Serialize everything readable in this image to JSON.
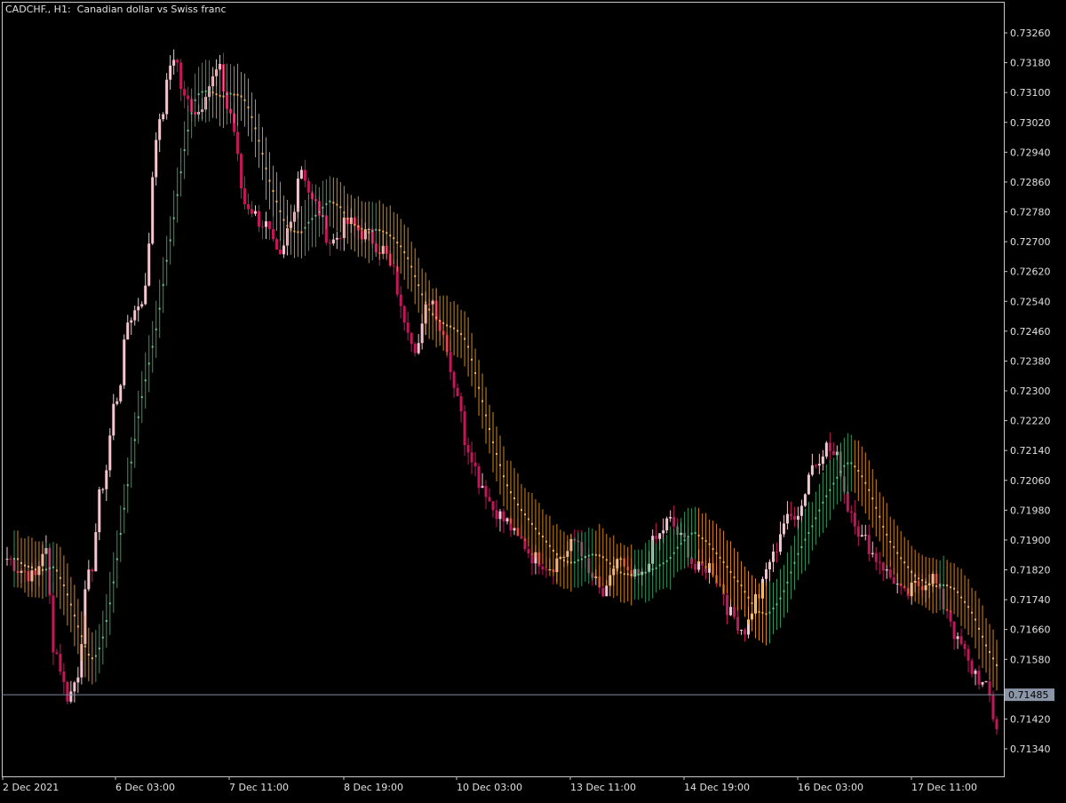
{
  "window": {
    "title": "CADCHF., H1:  Canadian dollar vs Swiss franc"
  },
  "colors": {
    "background": "#000000",
    "frame": "#c8c8c8",
    "text": "#e0e0e0",
    "bull_candle": "#f4c6cf",
    "bear_candle": "#c2185b",
    "band_up": "#3cb371",
    "band_down": "#ff9f1a",
    "price_line": "#7a8aa0",
    "price_label_bg": "#8a96a8"
  },
  "chart_data": {
    "type": "candlestick",
    "symbol": "CADCHF.",
    "timeframe": "H1",
    "description": "Canadian dollar vs Swiss franc",
    "ylim": [
      0.713,
      0.733
    ],
    "y_ticks": [
      "0.73260",
      "0.73180",
      "0.73100",
      "0.73020",
      "0.72940",
      "0.72860",
      "0.72780",
      "0.72700",
      "0.72620",
      "0.72540",
      "0.72460",
      "0.72380",
      "0.72300",
      "0.72220",
      "0.72140",
      "0.72060",
      "0.71980",
      "0.71900",
      "0.71820",
      "0.71740",
      "0.71660",
      "0.71580",
      "0.71420",
      "0.71340"
    ],
    "x_ticks": [
      "2 Dec 2021",
      "6 Dec 03:00",
      "7 Dec 11:00",
      "8 Dec 19:00",
      "10 Dec 03:00",
      "13 Dec 11:00",
      "14 Dec 19:00",
      "16 Dec 03:00",
      "17 Dec 11:00"
    ],
    "current_price": "0.71485",
    "current_price_value": 0.71485,
    "bar_count": 280,
    "price_path": [
      [
        0,
        0.7185
      ],
      [
        8,
        0.7182
      ],
      [
        16,
        0.718
      ],
      [
        22,
        0.7188
      ],
      [
        28,
        0.716
      ],
      [
        36,
        0.7148
      ],
      [
        40,
        0.7152
      ],
      [
        48,
        0.718
      ],
      [
        56,
        0.7205
      ],
      [
        64,
        0.7228
      ],
      [
        72,
        0.725
      ],
      [
        80,
        0.7255
      ],
      [
        88,
        0.73
      ],
      [
        98,
        0.732
      ],
      [
        104,
        0.7308
      ],
      [
        112,
        0.7305
      ],
      [
        118,
        0.7312
      ],
      [
        124,
        0.7316
      ],
      [
        130,
        0.7305
      ],
      [
        140,
        0.728
      ],
      [
        150,
        0.7275
      ],
      [
        160,
        0.7265
      ],
      [
        166,
        0.7275
      ],
      [
        172,
        0.729
      ],
      [
        180,
        0.728
      ],
      [
        190,
        0.727
      ],
      [
        200,
        0.7275
      ],
      [
        210,
        0.7272
      ],
      [
        220,
        0.7268
      ],
      [
        226,
        0.7262
      ],
      [
        232,
        0.725
      ],
      [
        240,
        0.7242
      ],
      [
        248,
        0.7255
      ],
      [
        256,
        0.7245
      ],
      [
        262,
        0.7232
      ],
      [
        270,
        0.7215
      ],
      [
        278,
        0.7205
      ],
      [
        286,
        0.7198
      ],
      [
        292,
        0.7195
      ],
      [
        300,
        0.719
      ],
      [
        310,
        0.7185
      ],
      [
        318,
        0.7183
      ],
      [
        326,
        0.7186
      ],
      [
        334,
        0.719
      ],
      [
        342,
        0.718
      ],
      [
        350,
        0.7175
      ],
      [
        358,
        0.7185
      ],
      [
        364,
        0.718
      ],
      [
        372,
        0.718
      ],
      [
        380,
        0.719
      ],
      [
        388,
        0.7195
      ],
      [
        396,
        0.719
      ],
      [
        404,
        0.7182
      ],
      [
        412,
        0.7183
      ],
      [
        418,
        0.7178
      ],
      [
        424,
        0.717
      ],
      [
        432,
        0.7166
      ],
      [
        440,
        0.7175
      ],
      [
        448,
        0.7185
      ],
      [
        456,
        0.7195
      ],
      [
        464,
        0.7198
      ],
      [
        472,
        0.721
      ],
      [
        480,
        0.7215
      ],
      [
        486,
        0.7212
      ],
      [
        494,
        0.7198
      ],
      [
        502,
        0.719
      ],
      [
        510,
        0.7185
      ],
      [
        518,
        0.718
      ],
      [
        526,
        0.7175
      ],
      [
        534,
        0.7178
      ],
      [
        542,
        0.718
      ],
      [
        550,
        0.7172
      ],
      [
        558,
        0.7162
      ],
      [
        566,
        0.7155
      ],
      [
        574,
        0.715
      ],
      [
        580,
        0.714
      ]
    ]
  }
}
